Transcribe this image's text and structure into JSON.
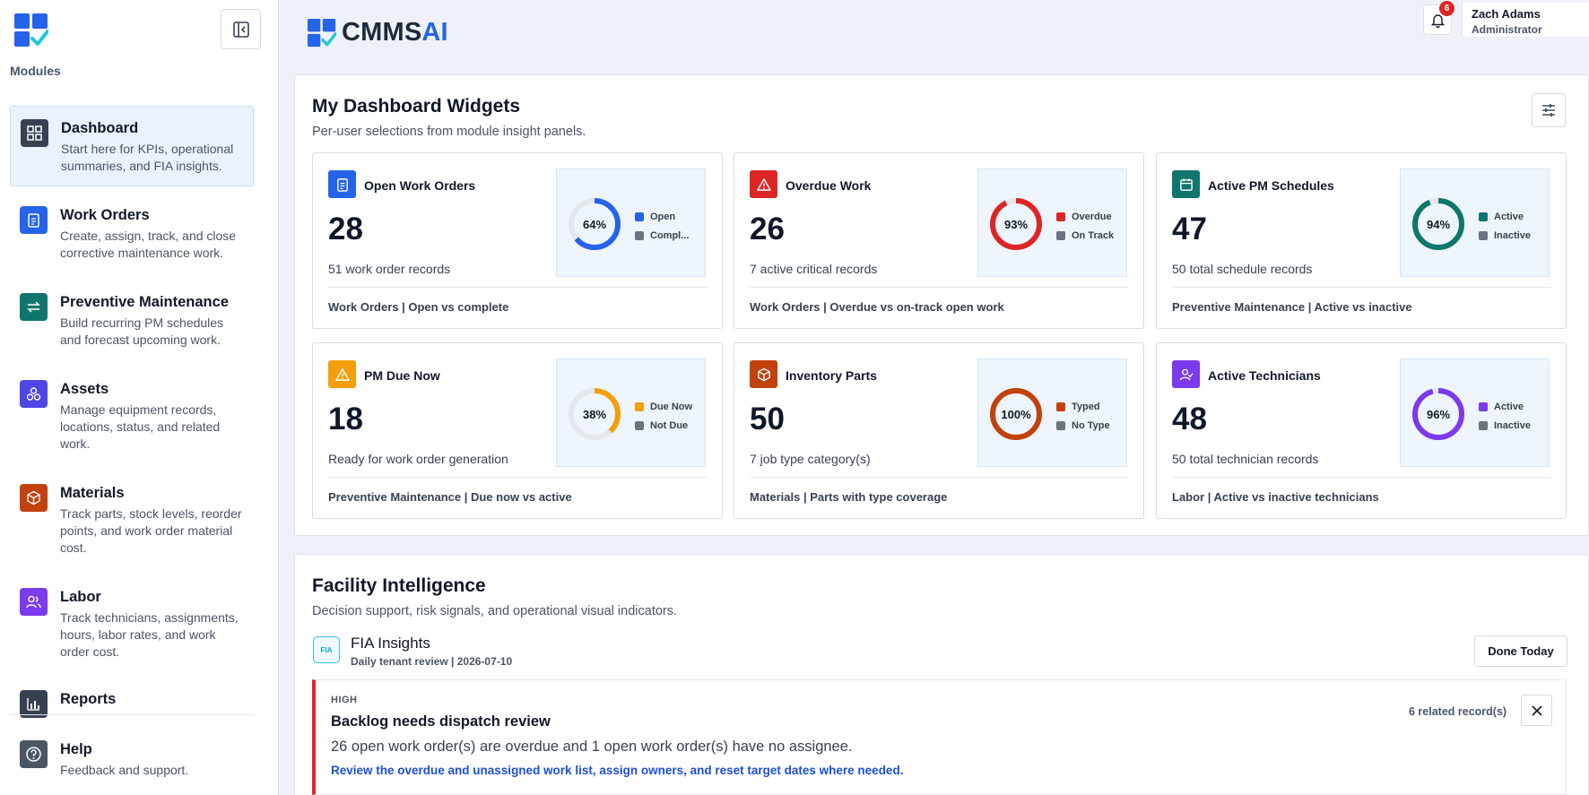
{
  "sidebar": {
    "modules_label": "Modules",
    "items": [
      {
        "title": "Dashboard",
        "desc": "Start here for KPIs, operational summaries, and FIA insights.",
        "color": "#374151"
      },
      {
        "title": "Work Orders",
        "desc": "Create, assign, track, and close corrective maintenance work.",
        "color": "#2563eb"
      },
      {
        "title": "Preventive Maintenance",
        "desc": "Build recurring PM schedules and forecast upcoming work.",
        "color": "#0f766e"
      },
      {
        "title": "Assets",
        "desc": "Manage equipment records, locations, status, and related work.",
        "color": "#4f46e5"
      },
      {
        "title": "Materials",
        "desc": "Track parts, stock levels, reorder points, and work order material cost.",
        "color": "#c2410c"
      },
      {
        "title": "Labor",
        "desc": "Track technicians, assignments, hours, labor rates, and work order cost.",
        "color": "#7c3aed"
      },
      {
        "title": "Reports",
        "desc": "",
        "color": "#374151"
      },
      {
        "title": "Help",
        "desc": "Feedback and support.",
        "color": "#4b5563"
      }
    ]
  },
  "header": {
    "brand_main": "CMMS",
    "brand_accent": "AI",
    "notification_count": "6",
    "user_name": "Zach Adams",
    "user_role": "Administrator"
  },
  "widgets_panel": {
    "title": "My Dashboard Widgets",
    "subtitle": "Per-user selections from module insight panels.",
    "widgets": [
      {
        "title": "Open Work Orders",
        "value": "28",
        "desc": "51 work order records",
        "footer": "Work Orders | Open vs complete",
        "percent": 64,
        "percent_label": "64%",
        "color": "#2563eb",
        "icon": "clipboard-icon",
        "legend": [
          "Open",
          "Compl..."
        ]
      },
      {
        "title": "Overdue Work",
        "value": "26",
        "desc": "7 active critical records",
        "footer": "Work Orders | Overdue vs on-track open work",
        "percent": 93,
        "percent_label": "93%",
        "color": "#dc2626",
        "icon": "warning-icon",
        "legend": [
          "Overdue",
          "On Track"
        ]
      },
      {
        "title": "Active PM Schedules",
        "value": "47",
        "desc": "50 total schedule records",
        "footer": "Preventive Maintenance | Active vs inactive",
        "percent": 94,
        "percent_label": "94%",
        "color": "#0f766e",
        "icon": "calendar-icon",
        "legend": [
          "Active",
          "Inactive"
        ]
      },
      {
        "title": "PM Due Now",
        "value": "18",
        "desc": "Ready for work order generation",
        "footer": "Preventive Maintenance | Due now vs active",
        "percent": 38,
        "percent_label": "38%",
        "color": "#f59e0b",
        "icon": "warning-icon",
        "legend": [
          "Due Now",
          "Not Due"
        ]
      },
      {
        "title": "Inventory Parts",
        "value": "50",
        "desc": "7 job type category(s)",
        "footer": "Materials | Parts with type coverage",
        "percent": 100,
        "percent_label": "100%",
        "color": "#c2410c",
        "icon": "box-icon",
        "legend": [
          "Typed",
          "No Type"
        ]
      },
      {
        "title": "Active Technicians",
        "value": "48",
        "desc": "50 total technician records",
        "footer": "Labor | Active vs inactive technicians",
        "percent": 96,
        "percent_label": "96%",
        "color": "#7c3aed",
        "icon": "user-icon",
        "legend": [
          "Active",
          "Inactive"
        ]
      }
    ]
  },
  "facility": {
    "title": "Facility Intelligence",
    "subtitle": "Decision support, risk signals, and operational visual indicators.",
    "fia_icon_text": "FIA",
    "fia_title": "FIA Insights",
    "fia_sub": "Daily tenant review | 2026-07-10",
    "done_label": "Done Today",
    "alert": {
      "severity": "HIGH",
      "title": "Backlog needs dispatch review",
      "body": "26 open work order(s) are overdue and 1 open work order(s) have no assignee.",
      "action": "Review the overdue and unassigned work list, assign owners, and reset target dates where needed.",
      "related": "6 related record(s)"
    }
  }
}
